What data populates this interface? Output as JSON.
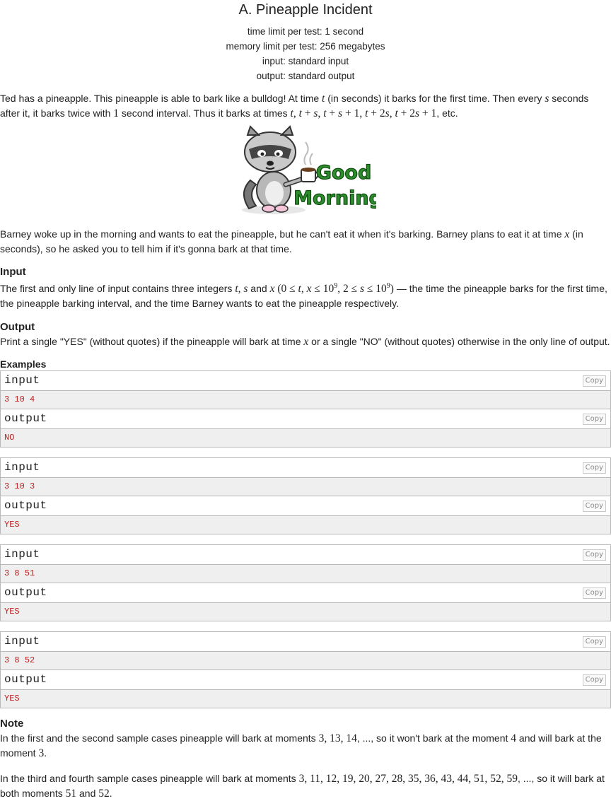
{
  "problem": {
    "title": "A. Pineapple Incident",
    "time_limit": "time limit per test: 1 second",
    "memory_limit": "memory limit per test: 256 megabytes",
    "input": "input: standard input",
    "output": "output: standard output"
  },
  "statement": {
    "p1_a": "Ted has a pineapple. This pineapple is able to bark like a bulldog! At time ",
    "p1_b": " (in seconds) it barks for the first time. Then every ",
    "p1_c": " seconds after it, it barks twice with ",
    "p1_d": " second interval. Thus it barks at times ",
    "p1_e": ", etc.",
    "image_text": "Good Morning",
    "p2_a": "Barney woke up in the morning and wants to eat the pineapple, but he can't eat it when it's barking. Barney plans to eat it at time ",
    "p2_b": " (in seconds), so he asked you to tell him if it's gonna bark at that time."
  },
  "input_section": {
    "title": "Input",
    "text_a": "The first and only line of input contains three integers ",
    "text_b": " and ",
    "text_c": " — the time the pineapple barks for the first time, the pineapple barking interval, and the time Barney wants to eat the pineapple respectively."
  },
  "output_section": {
    "title": "Output",
    "text_a": "Print a single \"YES\" (without quotes) if the pineapple will bark at time ",
    "text_b": " or a single \"NO\" (without quotes) otherwise in the only line of output."
  },
  "examples": {
    "title": "Examples",
    "input_label": "input",
    "output_label": "output",
    "copy_label": "Copy",
    "tests": [
      {
        "input": "3 10 4",
        "output": "NO"
      },
      {
        "input": "3 10 3",
        "output": "YES"
      },
      {
        "input": "3 8 51",
        "output": "YES"
      },
      {
        "input": "3 8 52",
        "output": "YES"
      }
    ]
  },
  "note": {
    "title": "Note",
    "p1_a": "In the first and the second sample cases pineapple will bark at moments ",
    "p1_b": ", ..., so it won't bark at the moment ",
    "p1_c": " and will bark at the moment ",
    "p2_a": "In the third and fourth sample cases pineapple will bark at moments ",
    "p2_b": ", ..., so it will bark at both moments ",
    "p2_c": " and "
  }
}
